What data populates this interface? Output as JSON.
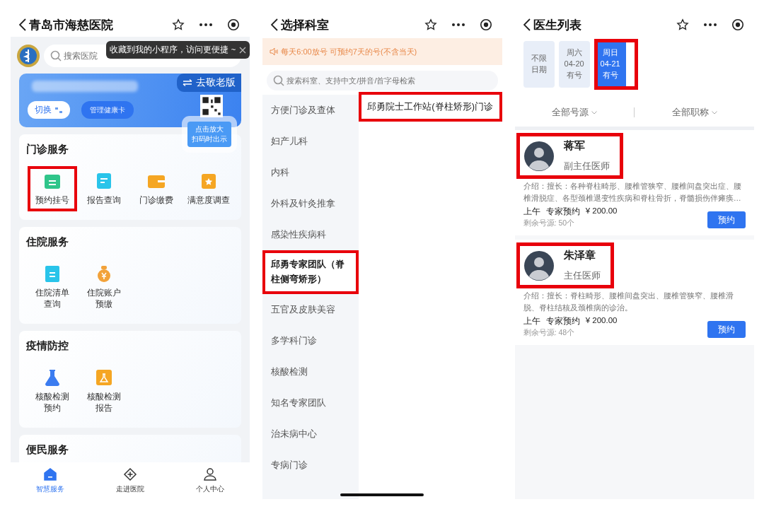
{
  "home": {
    "title": "青岛市海慈医院",
    "tooltip": "收藏到我的小程序，访问更便捷 ~",
    "search": {
      "placeholder": "搜索医院"
    },
    "card": {
      "elder_button": "去敬老版",
      "switch_button": "切换",
      "manage_button": "管理健康卡",
      "qr_hint": [
        "点击放大",
        "扫码时出示"
      ]
    },
    "sections": [
      {
        "title": "门诊服务",
        "items": [
          {
            "kind": "calendar",
            "lines": [
              "预约挂号"
            ],
            "highlighted": true
          },
          {
            "kind": "document",
            "lines": [
              "报告查询"
            ],
            "highlighted": false
          },
          {
            "kind": "wallet",
            "lines": [
              "门诊缴费"
            ],
            "highlighted": false
          },
          {
            "kind": "star",
            "lines": [
              "满意度调查"
            ],
            "highlighted": false
          }
        ]
      },
      {
        "title": "住院服务",
        "items": [
          {
            "kind": "clipboard",
            "lines": [
              "住院清单",
              "查询"
            ],
            "highlighted": false
          },
          {
            "kind": "moneybag",
            "lines": [
              "住院账户",
              "预缴"
            ],
            "highlighted": false
          }
        ]
      },
      {
        "title": "疫情防控",
        "items": [
          {
            "kind": "flask",
            "lines": [
              "核酸检测",
              "预约"
            ],
            "highlighted": false
          },
          {
            "kind": "beaker",
            "lines": [
              "核酸检测",
              "报告"
            ],
            "highlighted": false
          }
        ]
      },
      {
        "title": "便民服务"
      }
    ],
    "tabbar": [
      {
        "kind": "home",
        "label": "智慧服务",
        "selected": true
      },
      {
        "kind": "hospital",
        "label": "走进医院",
        "selected": false
      },
      {
        "kind": "person",
        "label": "个人中心",
        "selected": false
      }
    ]
  },
  "departments": {
    "title": "选择科室",
    "notice": "每天6:00放号 可预约7天的号(不含当天)",
    "search": {
      "placeholder": "搜索科室、支持中文/拼音/首字母检索"
    },
    "categories": [
      {
        "label": "方便门诊及查体",
        "selected": false,
        "highlighted": false
      },
      {
        "label": "妇产儿科",
        "selected": false,
        "highlighted": false
      },
      {
        "label": "内科",
        "selected": false,
        "highlighted": false
      },
      {
        "label": "外科及针灸推拿",
        "selected": false,
        "highlighted": false
      },
      {
        "label": "感染性疾病科",
        "selected": false,
        "highlighted": false
      },
      {
        "label": "邱勇专家团队（脊柱侧弯矫形）",
        "selected": true,
        "highlighted": true
      },
      {
        "label": "五官及皮肤美容",
        "selected": false,
        "highlighted": false
      },
      {
        "label": "多学科门诊",
        "selected": false,
        "highlighted": false
      },
      {
        "label": "核酸检测",
        "selected": false,
        "highlighted": false
      },
      {
        "label": "知名专家团队",
        "selected": false,
        "highlighted": false
      },
      {
        "label": "治未病中心",
        "selected": false,
        "highlighted": false
      },
      {
        "label": "专病门诊",
        "selected": false,
        "highlighted": false
      }
    ],
    "clinics": [
      {
        "label": "邱勇院士工作站(脊柱矫形)门诊",
        "highlighted": true
      }
    ]
  },
  "doctors": {
    "title": "医生列表",
    "dates": [
      {
        "lines": [
          "不限",
          "日期"
        ],
        "selected": false,
        "highlighted": false
      },
      {
        "lines": [
          "周六",
          "04-20",
          "有号"
        ],
        "selected": false,
        "highlighted": false
      },
      {
        "lines": [
          "周日",
          "04-21",
          "有号"
        ],
        "selected": true,
        "highlighted": true
      }
    ],
    "filters": [
      "全部号源",
      "全部职称"
    ],
    "list": [
      {
        "name": "蒋军",
        "title": "副主任医师",
        "highlighted": true,
        "intro": "介绍：擅长：各种脊柱畸形、腰椎管狭窄、腰椎间盘突出症、腰椎滑脱症、各型颈椎退变性疾病和脊柱骨折，脊髓损伤伴瘫痪…",
        "session": "上午",
        "type": "专家预约",
        "price": "¥ 200.00",
        "remaining": "剩余号源: 50个",
        "book_button": "预约"
      },
      {
        "name": "朱泽章",
        "title": "主任医师",
        "highlighted": true,
        "intro": "介绍：擅长：脊柱畸形、腰椎间盘突出、腰椎管狭窄、腰椎滑脱、脊柱结核及颈椎病的诊治。",
        "session": "上午",
        "type": "专家预约",
        "price": "¥ 200.00",
        "remaining": "剩余号源: 48个",
        "book_button": "预约"
      }
    ]
  }
}
